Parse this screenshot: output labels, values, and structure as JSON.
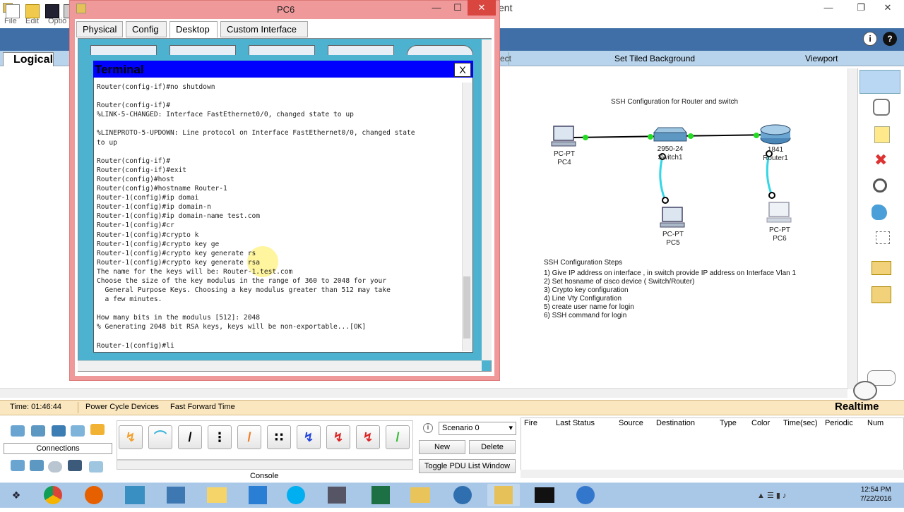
{
  "app": {
    "title_fragment": "ent",
    "menu": [
      "File",
      "Edit",
      "Optio"
    ],
    "subbar": {
      "left_fragment": "ect",
      "tiled_background": "Set Tiled Background",
      "viewport": "Viewport"
    },
    "logical_tab": "Logical"
  },
  "pc6": {
    "title": "PC6",
    "tabs": [
      {
        "label": "Physical"
      },
      {
        "label": "Config"
      },
      {
        "label": "Desktop"
      },
      {
        "label": "Custom Interface"
      }
    ],
    "terminal": {
      "title": "Terminal",
      "close": "X",
      "lines": [
        "Router(config-if)#no shutdown",
        "",
        "Router(config-if)#",
        "%LINK-5-CHANGED: Interface FastEthernet0/0, changed state to up",
        "",
        "%LINEPROTO-5-UPDOWN: Line protocol on Interface FastEthernet0/0, changed state",
        "to up",
        "",
        "Router(config-if)#",
        "Router(config-if)#exit",
        "Router(config)#host",
        "Router(config)#hostname Router-1",
        "Router-1(config)#ip domai",
        "Router-1(config)#ip domain-n",
        "Router-1(config)#ip domain-name test.com",
        "Router-1(config)#cr",
        "Router-1(config)#crypto k",
        "Router-1(config)#crypto key ge",
        "Router-1(config)#crypto key generate rs",
        "Router-1(config)#crypto key generate rsa",
        "The name for the keys will be: Router-1.test.com",
        "Choose the size of the key modulus in the range of 360 to 2048 for your",
        "  General Purpose Keys. Choosing a key modulus greater than 512 may take",
        "  a few minutes.",
        "",
        "How many bits in the modulus [512]: 2048",
        "% Generating 2048 bit RSA keys, keys will be non-exportable...[OK]",
        "",
        "Router-1(config)#li"
      ]
    }
  },
  "topology": {
    "title": "SSH Configuration for Router and switch",
    "devices": {
      "pc4": {
        "type": "PC-PT",
        "name": "PC4"
      },
      "switch1": {
        "type": "2950-24",
        "name": "Switch1"
      },
      "router1": {
        "type": "1841",
        "name": "Router1"
      },
      "pc5": {
        "type": "PC-PT",
        "name": "PC5"
      },
      "pc6": {
        "type": "PC-PT",
        "name": "PC6"
      }
    },
    "steps_title": "SSH Configuration Steps",
    "steps": [
      "1) Give IP address on interface , in switch provide IP address on Interface Vlan 1",
      "2) Set hosname of cisco device ( Switch/Router)",
      "3) Crypto key configuration",
      "4) Line Vty Configuration",
      "5) create user name for login",
      "6) SSH command for login"
    ]
  },
  "status_bar": {
    "time": "Time: 01:46:44",
    "power_cycle": "Power Cycle Devices",
    "fast_forward": "Fast Forward Time",
    "mode": "Realtime"
  },
  "bottom": {
    "connections": "Connections",
    "console": "Console",
    "scenario": "Scenario 0",
    "new": "New",
    "delete": "Delete",
    "toggle_pdu": "Toggle PDU List Window",
    "pdu_columns": [
      "Fire",
      "Last Status",
      "Source",
      "Destination",
      "Type",
      "Color",
      "Time(sec)",
      "Periodic",
      "Num"
    ]
  },
  "taskbar": {
    "time": "12:54 PM",
    "date": "7/22/2016"
  },
  "colors": {
    "toolbar": "#3f6fa6",
    "terminal_title": "#0000ff",
    "pc6_frame": "#f0999a",
    "desktop_bg": "#4db2d0",
    "link_up": "#22dd22",
    "console_cable": "#33d6e6"
  }
}
